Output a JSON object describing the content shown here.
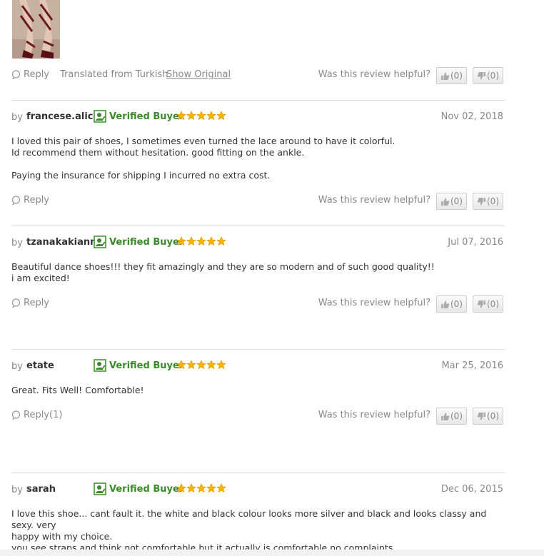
{
  "first_review_tail": {
    "photo_icon": "review-photo-sandals",
    "reply_label": "Reply",
    "translated_text": "Translated from Turkish",
    "show_original_label": "Show Original",
    "helpful_label": "Was this review helpful?",
    "up_count": "(0)",
    "down_count": "(0)"
  },
  "common": {
    "by_label": "by",
    "verified_label": "Verified Buyer",
    "helpful_label": "Was this review helpful?",
    "star_color": "#f5b400",
    "verified_color": "#3b8a2a"
  },
  "reviews": [
    {
      "username": "francese.alice",
      "date": "Nov 02, 2018",
      "rating": 5,
      "lines": [
        "I loved this pair of shoes, I sometimes even turned the lace around to have it colorful.",
        "Id recommend them without hesitation. good fitting on the ankle.",
        "Paying the insurance for shipping I incurred no extra cost."
      ],
      "reply_label": "Reply",
      "up_count": "(0)",
      "down_count": "(0)"
    },
    {
      "username": "tzanakakianna",
      "date": "Jul 07, 2016",
      "rating": 5,
      "lines": [
        "Beautiful dance shoes!!! they fit amazingly and they are so modern and of such good quality!!",
        "i am excited!"
      ],
      "reply_label": "Reply",
      "up_count": "(0)",
      "down_count": "(0)"
    },
    {
      "username": "etate",
      "date": "Mar 25, 2016",
      "rating": 5,
      "lines": [
        "Great. Fits Well! Comfortable!"
      ],
      "reply_label": "Reply(1)",
      "up_count": "(0)",
      "down_count": "(0)"
    },
    {
      "username": "sarah",
      "date": "Dec 06, 2015",
      "rating": 5,
      "lines": [
        "I love this shoe... cant fault it. the white and black colour looks more silver and black and looks classy and sexy. very",
        "happy with my choice.",
        "you see straps and think not comfortable but it actually is comfortable no complaints."
      ]
    }
  ]
}
